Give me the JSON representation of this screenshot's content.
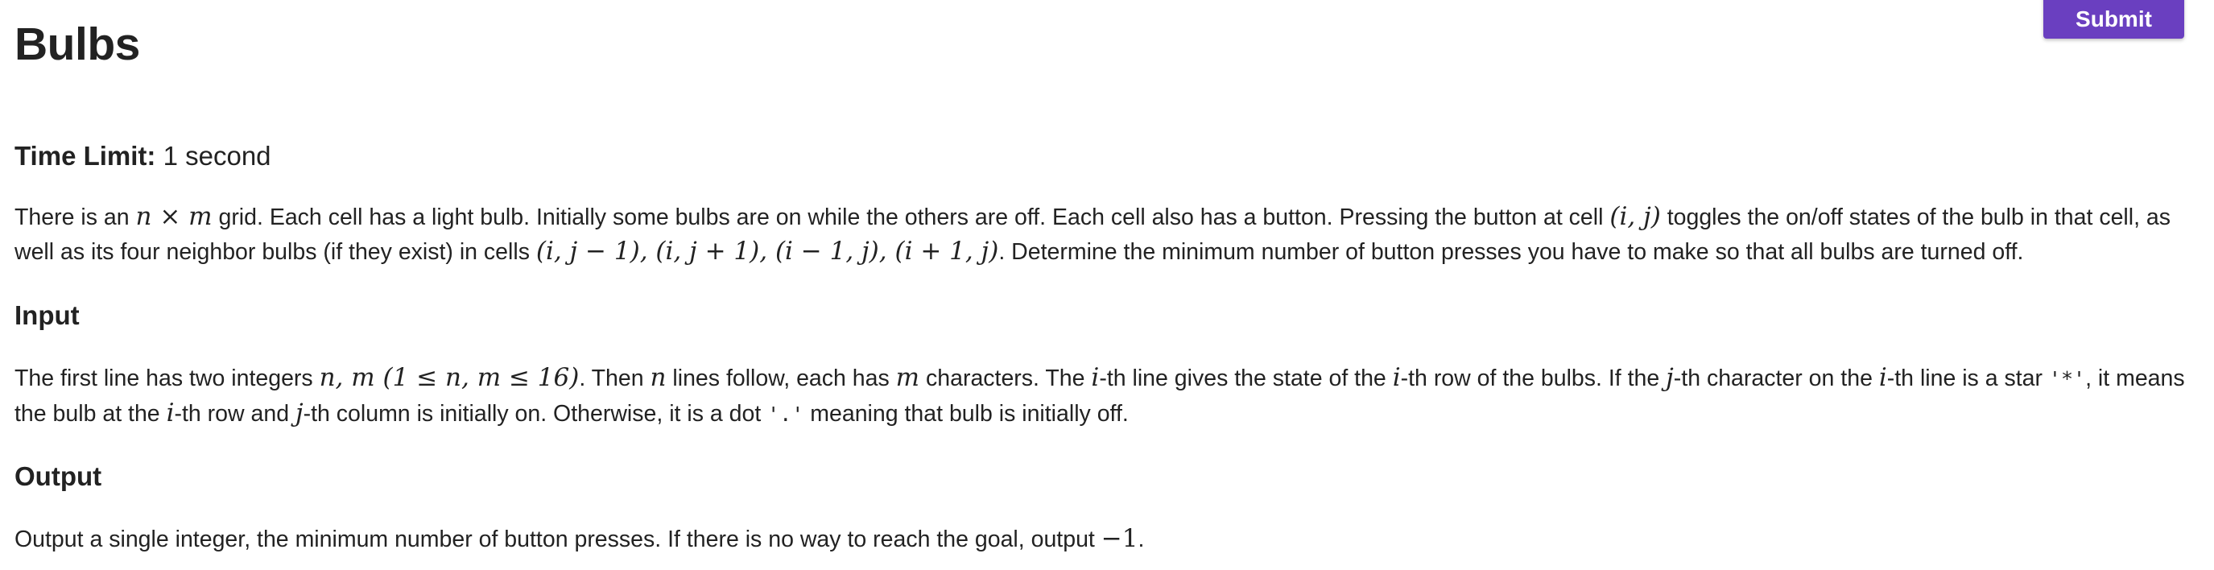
{
  "problem": {
    "title": "Bulbs",
    "submit_label": "Submit",
    "time_limit_label": "Time Limit:",
    "time_limit_value": "1 second"
  },
  "statement": {
    "t1": "There is an ",
    "m1": "n × m",
    "t2": " grid. Each cell has a light bulb. Initially some bulbs are on while the others are off. Each cell also has a button. Pressing the button at cell ",
    "m2": "(i, j)",
    "t3": " toggles the on/off states of the bulb in that cell, as well as its four neighbor bulbs (if they exist) in cells ",
    "m3": "(i, j − 1), (i, j + 1), (i − 1, j), (i + 1, j)",
    "t4": ". Determine the minimum number of button presses you have to make so that all bulbs are turned off."
  },
  "input_section": {
    "heading": "Input",
    "t1": "The first line has two integers ",
    "m1": "n, m",
    "m2": " (1 ≤ n, m ≤ 16)",
    "t2": ". Then ",
    "m3": "n",
    "t3": " lines follow, each has ",
    "m4": "m",
    "t4": " characters. The ",
    "m5": "i",
    "t5": "-th line gives the state of the ",
    "m6": "i",
    "t6": "-th row of the bulbs. If the ",
    "m7": "j",
    "t7": "-th character on the ",
    "m8": "i",
    "t8": "-th line is a star ",
    "c1": "'*'",
    "t9": ", it means the bulb at the ",
    "m9": "i",
    "t10": "-th row and ",
    "m10": "j",
    "t11": "-th column is initially on. Otherwise, it is a dot ",
    "c2": "'.'",
    "t12": " meaning that bulb is initially off."
  },
  "output_section": {
    "heading": "Output",
    "t1": "Output a single integer, the minimum number of button presses. If there is no way to reach the goal, output ",
    "m1": "−1",
    "t2": "."
  },
  "colors": {
    "submit_bg": "#6a3fc0",
    "text": "#222222"
  }
}
